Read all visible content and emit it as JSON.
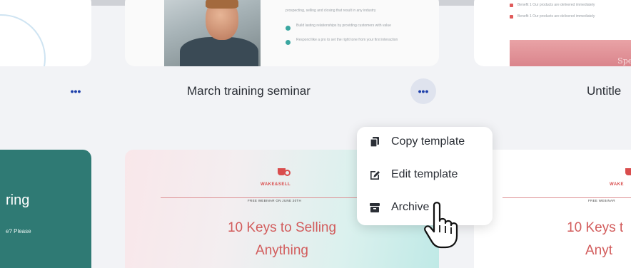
{
  "grid": {
    "top_row": {
      "middle_card": {
        "doc_lines": [
          "prospecting, selling and closing that result in any industry",
          "Build lasting relationships by providing customers with value",
          "Respond like a pro to set the right tone from your first interaction"
        ]
      },
      "right_card": {
        "doc_lines": [
          "Benefit 1 Our products are delivered immediately",
          "Benefit 1 Our products are delivered immediately"
        ],
        "banner_text": "Special"
      }
    },
    "title_row": {
      "middle_title": "March training seminar",
      "right_title": "Untitle",
      "more_glyph": "•••"
    },
    "bottom_row": {
      "left_card": {
        "heading": "ring",
        "sub": "e? Please"
      },
      "middle_card": {
        "brand": "WAKE&SELL",
        "subline": "FREE WEBINAR ON JUNE 20TH",
        "headline_line1": "10 Keys to Selling",
        "headline_line2": "Anything"
      },
      "right_card": {
        "brand": "WAKE",
        "subline": "FREE WEBINAR",
        "headline_line1": "10 Keys t",
        "headline_line2": "Anyt"
      }
    }
  },
  "menu": {
    "items": [
      {
        "label": "Copy template",
        "icon": "copy-icon"
      },
      {
        "label": "Edit template",
        "icon": "edit-icon"
      },
      {
        "label": "Archive",
        "icon": "archive-icon"
      }
    ]
  },
  "colors": {
    "accent": "#1d3faa",
    "teal": "#2f7a74",
    "brand_red": "#d25c5c"
  }
}
